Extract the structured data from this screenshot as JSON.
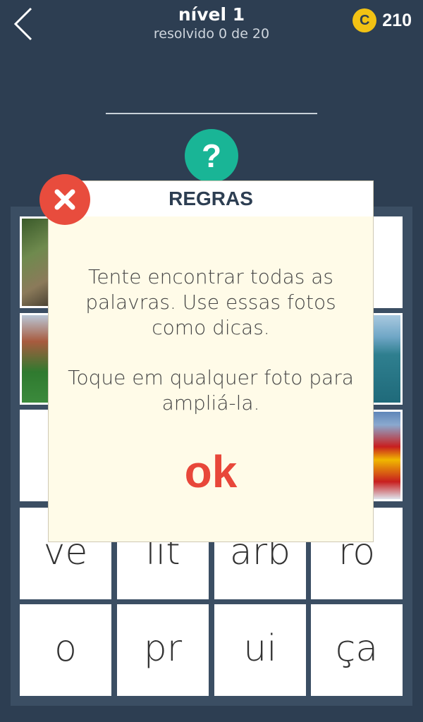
{
  "header": {
    "title": "nível 1",
    "subtitle": "resolvido 0 de 20",
    "coins": "210",
    "back_icon": "chevron-left-icon",
    "coin_icon": "coin-icon"
  },
  "help": {
    "label": "?"
  },
  "modal": {
    "title": "REGRAS",
    "text1": "Tente encontrar todas as palavras. Use essas fotos como dicas.",
    "text2": "Toque em qualquer foto para ampliá-la.",
    "ok_label": "ok"
  },
  "syllables": [
    "ve",
    "lit",
    "arb",
    "ro",
    "o",
    "pr",
    "ui",
    "ça"
  ],
  "colors": {
    "background": "#2d3e52",
    "accent_help": "#19b596",
    "accent_close": "#e84c3d",
    "ok_text": "#e8473a",
    "coin": "#f2c214"
  }
}
